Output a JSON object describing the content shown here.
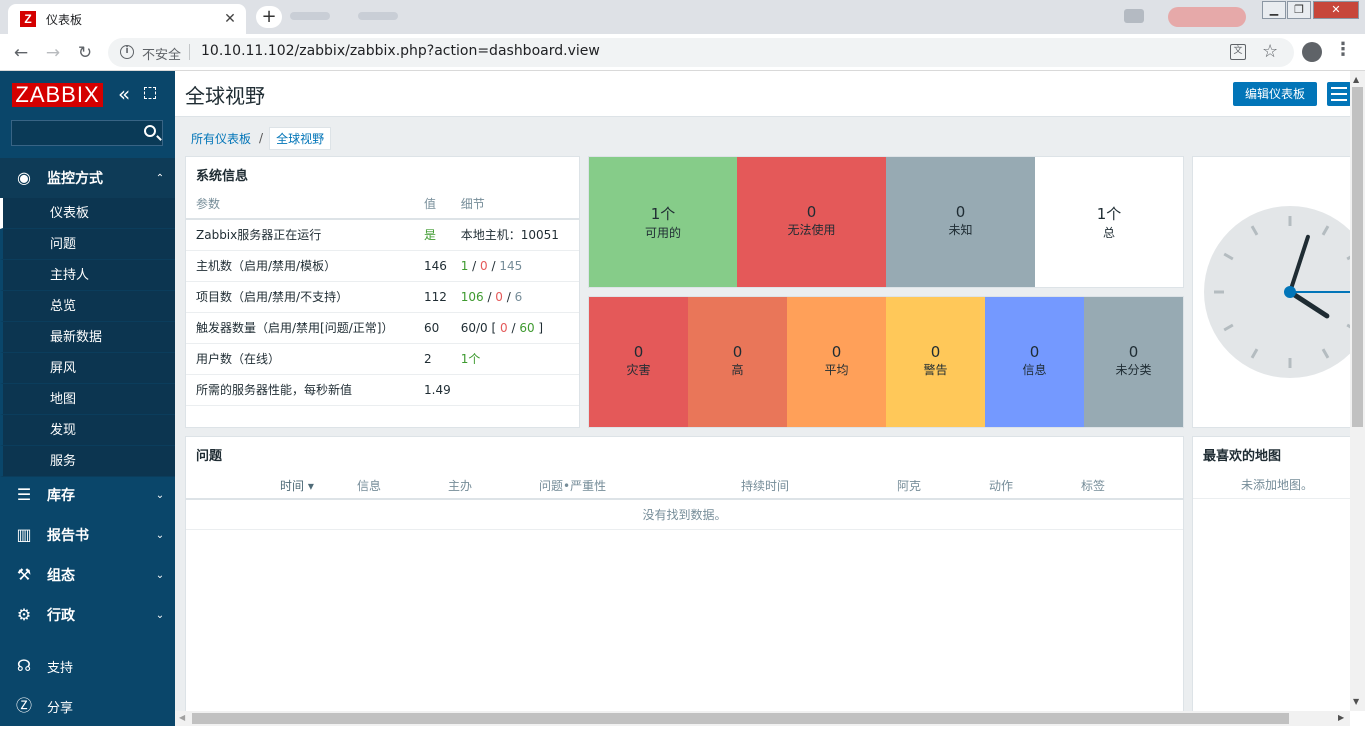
{
  "browser": {
    "tab_title": "仪表板",
    "tab_favicon": "Z",
    "not_secure": "不安全",
    "url": "10.10.11.102/zabbix/zabbix.php?action=dashboard.view"
  },
  "sidebar": {
    "logo": "ZABBIX",
    "monitoring": {
      "label": "监控方式",
      "icon": "eye-icon"
    },
    "submenu": [
      {
        "label": "仪表板",
        "active": true
      },
      {
        "label": "问题"
      },
      {
        "label": "主持人"
      },
      {
        "label": "总览"
      },
      {
        "label": "最新数据"
      },
      {
        "label": "屏风"
      },
      {
        "label": "地图"
      },
      {
        "label": "发现"
      },
      {
        "label": "服务"
      }
    ],
    "inventory": "库存",
    "reports": "报告书",
    "configuration": "组态",
    "administration": "行政",
    "support": "支持",
    "share": "分享"
  },
  "header": {
    "title": "全球视野",
    "edit_button": "编辑仪表板"
  },
  "breadcrumb": {
    "all": "所有仪表板",
    "sep": "/",
    "current": "全球视野"
  },
  "system_info": {
    "title": "系统信息",
    "columns": [
      "参数",
      "值",
      "细节"
    ],
    "rows": [
      {
        "param": "Zabbix服务器正在运行",
        "value": "是",
        "detail": "本地主机：10051"
      },
      {
        "param": "主机数（启用/禁用/模板）",
        "value": "146",
        "d1": "1",
        "d2": "0",
        "d3": "145"
      },
      {
        "param": "项目数（启用/禁用/不支持）",
        "value": "112",
        "d1": "106",
        "d2": "0",
        "d3": "6"
      },
      {
        "param": "触发器数量（启用/禁用[问题/正常]）",
        "value": "60",
        "dpre": "60/0 [",
        "d2": "0",
        "d3": "60",
        "dpost": "]"
      },
      {
        "param": "用户数（在线）",
        "value": "2",
        "d1": "1个"
      },
      {
        "param": "所需的服务器性能，每秒新值",
        "value": "1.49"
      }
    ]
  },
  "host_availability": [
    {
      "count": "1个",
      "label": "可用的",
      "color": "#86cc89"
    },
    {
      "count": "0",
      "label": "无法使用",
      "color": "#e45959"
    },
    {
      "count": "0",
      "label": "未知",
      "color": "#97aab3"
    },
    {
      "count": "1个",
      "label": "总",
      "color": "#ffffff"
    }
  ],
  "problems_by_severity": [
    {
      "count": "0",
      "label": "灾害",
      "color": "#e45959"
    },
    {
      "count": "0",
      "label": "高",
      "color": "#e97659"
    },
    {
      "count": "0",
      "label": "平均",
      "color": "#ffa059"
    },
    {
      "count": "0",
      "label": "警告",
      "color": "#ffc859"
    },
    {
      "count": "0",
      "label": "信息",
      "color": "#7499ff"
    },
    {
      "count": "0",
      "label": "未分类",
      "color": "#97aab3"
    }
  ],
  "problems": {
    "title": "问题",
    "columns": [
      "时间 ▾",
      "信息",
      "主办",
      "问题•严重性",
      "持续时间",
      "阿克",
      "动作",
      "标签"
    ],
    "empty": "没有找到数据。"
  },
  "favorite_maps": {
    "title": "最喜欢的地图",
    "empty": "未添加地图。"
  },
  "clock": {
    "hour": 4.1,
    "minute": 3,
    "second": 15
  }
}
